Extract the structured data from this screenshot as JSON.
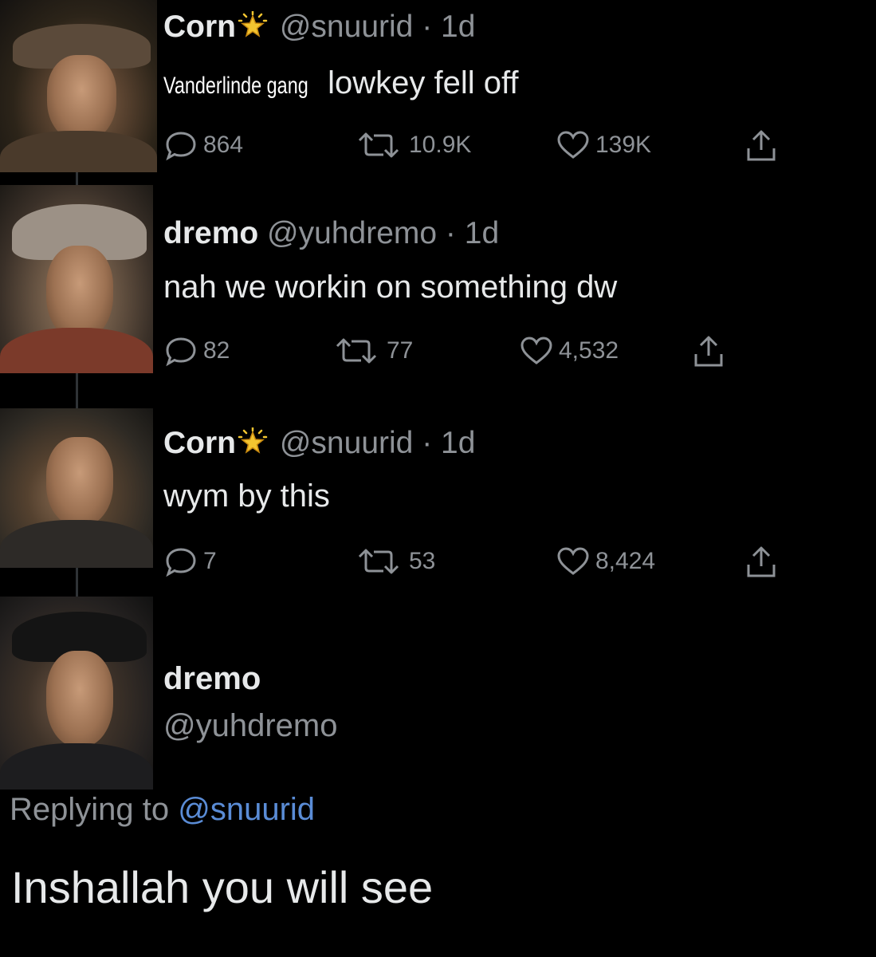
{
  "tweets": [
    {
      "name": "Corn",
      "handle": "@snuurid",
      "dot": "·",
      "date": "1d",
      "text_prefix": "Vanderlinde gang",
      "text": "lowkey fell off",
      "replies": "864",
      "retweets": "10.9K",
      "likes": "139K"
    },
    {
      "name": "dremo",
      "handle": "@yuhdremo",
      "dot": "·",
      "date": "1d",
      "text": "nah we workin on something dw",
      "replies": "82",
      "retweets": "77",
      "likes": "4,532"
    },
    {
      "name": "Corn",
      "handle": "@snuurid",
      "dot": "·",
      "date": "1d",
      "text": "wym by this",
      "replies": "7",
      "retweets": "53",
      "likes": "8,424"
    }
  ],
  "focused_tweet": {
    "name": "dremo",
    "handle": "@yuhdremo",
    "replying_label": "Replying to",
    "replying_to": "@snuurid",
    "text": "Inshallah you will see"
  },
  "icons": {
    "reply": "speech-bubble-icon",
    "retweet": "retweet-arrows-icon",
    "like": "heart-icon",
    "share": "share-upload-icon",
    "verified_star": "sparkle-star-emoji"
  },
  "colors": {
    "background": "#000000",
    "text_primary": "#e7e9ea",
    "text_secondary": "#8e9297",
    "mention": "#5a8cd6",
    "star": "#f2c530"
  }
}
